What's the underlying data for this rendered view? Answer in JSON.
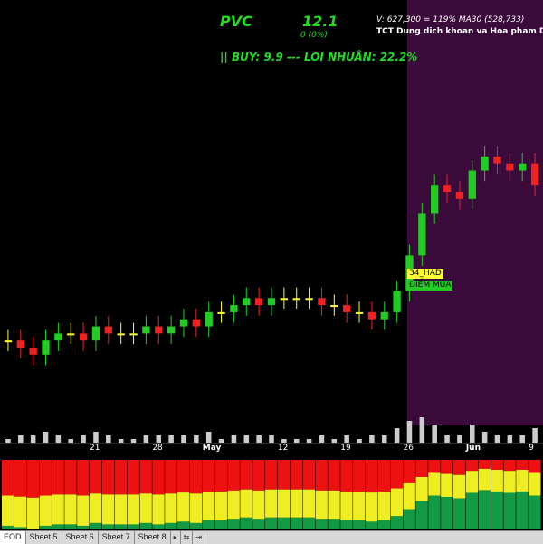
{
  "header": {
    "symbol": "PVC",
    "last_price": "12.1",
    "change": "0 (0%)",
    "buy_line": "|| BUY: 9.9  ---  LOI NHUÂN: 22.2%",
    "volume_line": "V: 627,300  =  119%  MA30 (528,733)",
    "company": "TCT Dung dich khoan va Hoa pham Dau k"
  },
  "markers": {
    "code_tag": "34_HAD",
    "buy_tag": "ĐIỂM MUA"
  },
  "x_axis": {
    "labels": [
      {
        "text": "21",
        "bold": false
      },
      {
        "text": "28",
        "bold": false
      },
      {
        "text": "May",
        "bold": true
      },
      {
        "text": "12",
        "bold": false
      },
      {
        "text": "19",
        "bold": false
      },
      {
        "text": "26",
        "bold": false
      },
      {
        "text": "Jun",
        "bold": true
      },
      {
        "text": "9",
        "bold": false
      }
    ]
  },
  "sheets": {
    "tabs": [
      "EOD",
      "Sheet 5",
      "Sheet 6",
      "Sheet 7",
      "Sheet 8"
    ],
    "active": "EOD",
    "nav": [
      "▸",
      "⇆",
      "⇥"
    ]
  },
  "colors": {
    "up": "#22cc22",
    "down": "#ee2222",
    "neutral": "#ffff33",
    "highlight_zone": "#3a0a3a",
    "volume": "#cccccc"
  },
  "chart_data": {
    "type": "candlestick",
    "x": [
      "Apr 15",
      "Apr 16",
      "Apr 17",
      "Apr 18",
      "Apr 19",
      "Apr 22",
      "Apr 23",
      "Apr 24",
      "Apr 25",
      "Apr 26",
      "Apr 29",
      "Apr 30",
      "May 1",
      "May 2",
      "May 3",
      "May 6",
      "May 7",
      "May 8",
      "May 9",
      "May 10",
      "May 13",
      "May 14",
      "May 15",
      "May 16",
      "May 17",
      "May 20",
      "May 21",
      "May 22",
      "May 23",
      "May 24",
      "May 27",
      "May 28",
      "May 29",
      "May 30",
      "May 31",
      "Jun 3",
      "Jun 4",
      "Jun 5",
      "Jun 6",
      "Jun 7",
      "Jun 10",
      "Jun 11",
      "Jun 12"
    ],
    "close": [
      9.2,
      9.1,
      9.0,
      9.2,
      9.3,
      9.3,
      9.2,
      9.4,
      9.3,
      9.3,
      9.3,
      9.4,
      9.3,
      9.4,
      9.5,
      9.4,
      9.6,
      9.6,
      9.7,
      9.8,
      9.7,
      9.8,
      9.8,
      9.8,
      9.8,
      9.7,
      9.7,
      9.6,
      9.6,
      9.5,
      9.6,
      9.9,
      10.4,
      11.0,
      11.4,
      11.3,
      11.2,
      11.6,
      11.8,
      11.7,
      11.6,
      11.7,
      11.4
    ],
    "annotations": [
      "34_HAD",
      "ĐIỂM MUA"
    ]
  }
}
